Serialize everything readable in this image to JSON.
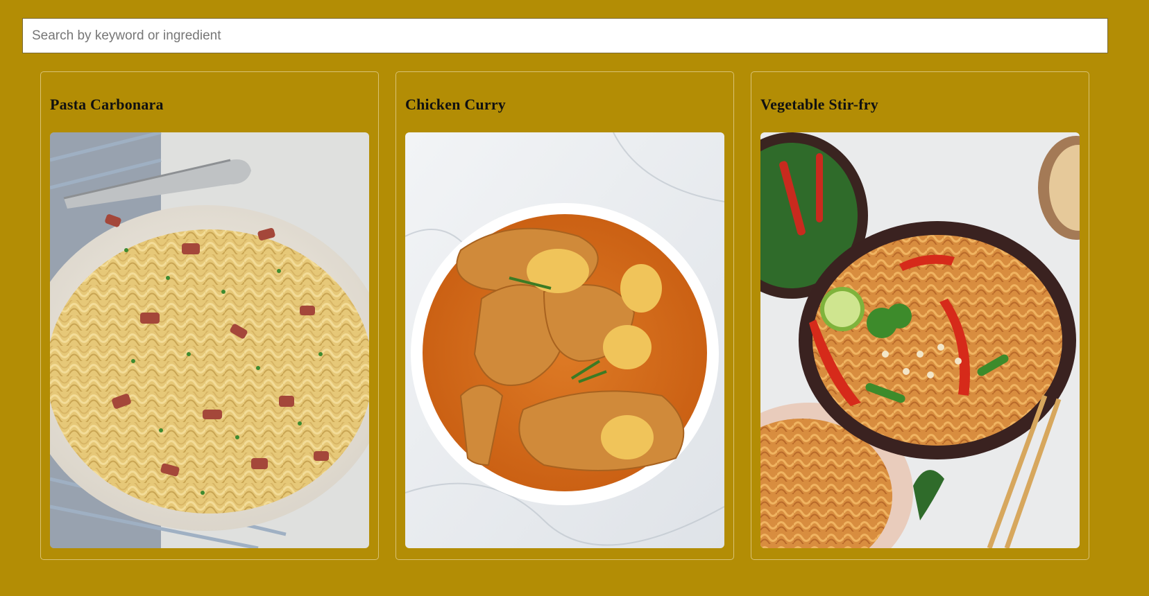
{
  "search": {
    "placeholder": "Search by keyword or ingredient",
    "value": ""
  },
  "recipes": [
    {
      "title": "Pasta Carbonara",
      "image": "pasta-carbonara-photo"
    },
    {
      "title": "Chicken Curry",
      "image": "chicken-curry-photo"
    },
    {
      "title": "Vegetable Stir-fry",
      "image": "vegetable-stir-fry-photo"
    }
  ],
  "colors": {
    "page_background": "#b38d05",
    "card_border": "#d9c375",
    "title_text": "#111111"
  }
}
